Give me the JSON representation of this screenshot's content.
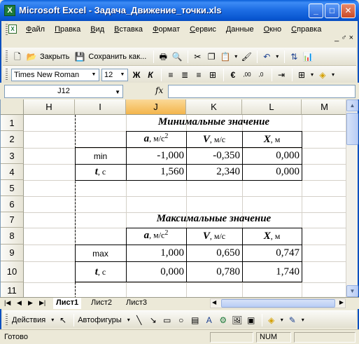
{
  "window": {
    "title": "Microsoft Excel - Задача_Движение_точки.xls",
    "app_icon_letter": "X",
    "minimize": "_",
    "maximize": "□",
    "close": "✕"
  },
  "menu": {
    "items": [
      "Файл",
      "Правка",
      "Вид",
      "Вставка",
      "Формат",
      "Сервис",
      "Данные",
      "Окно",
      "Справка"
    ],
    "mdi_controls": "_ ♂ ×"
  },
  "toolbar_standard": {
    "open_label": "Закрыть",
    "save_label": "Сохранить как..."
  },
  "toolbar_format": {
    "font_name": "Times New Roman",
    "font_size": "12",
    "bold": "Ж",
    "italic": "К",
    "currency": "€"
  },
  "formula_bar": {
    "name_box": "J12",
    "fx_label": "fx",
    "formula": ""
  },
  "sheet": {
    "columns": [
      "H",
      "I",
      "J",
      "K",
      "L",
      "M"
    ],
    "selected_column": "J",
    "rows": [
      "1",
      "2",
      "3",
      "4",
      "5",
      "6",
      "7",
      "8",
      "9",
      "10",
      "11"
    ],
    "table1": {
      "title": "Минимальные  значение",
      "header_a": "a",
      "header_a_unit": ", м/с",
      "header_a_exp": "2",
      "header_v": "V",
      "header_v_unit": ", м/с",
      "header_x": "X",
      "header_x_unit": ", м",
      "row3_label": "min",
      "row3_values": [
        "-1,000",
        "-0,350",
        "0,000"
      ],
      "row4_label_var": "t",
      "row4_label_unit": ", с",
      "row4_values": [
        "1,560",
        "2,340",
        "0,000"
      ]
    },
    "table2": {
      "title": "Максимальные значение",
      "header_a": "a",
      "header_a_unit": ", м/с",
      "header_a_exp": "2",
      "header_v": "V",
      "header_v_unit": ", м/с",
      "header_x": "X",
      "header_x_unit": ", м",
      "row9_label": "max",
      "row9_values": [
        "1,000",
        "0,650",
        "0,747"
      ],
      "row10_label_var": "t",
      "row10_label_unit": ", с",
      "row10_values": [
        "0,000",
        "0,780",
        "1,740"
      ]
    }
  },
  "tabs": {
    "items": [
      "Лист1",
      "Лист2",
      "Лист3"
    ],
    "active": "Лист1"
  },
  "drawing_toolbar": {
    "actions_label": "Действия",
    "autoshapes_label": "Автофигуры"
  },
  "status": {
    "text": "Готово",
    "num": "NUM"
  }
}
